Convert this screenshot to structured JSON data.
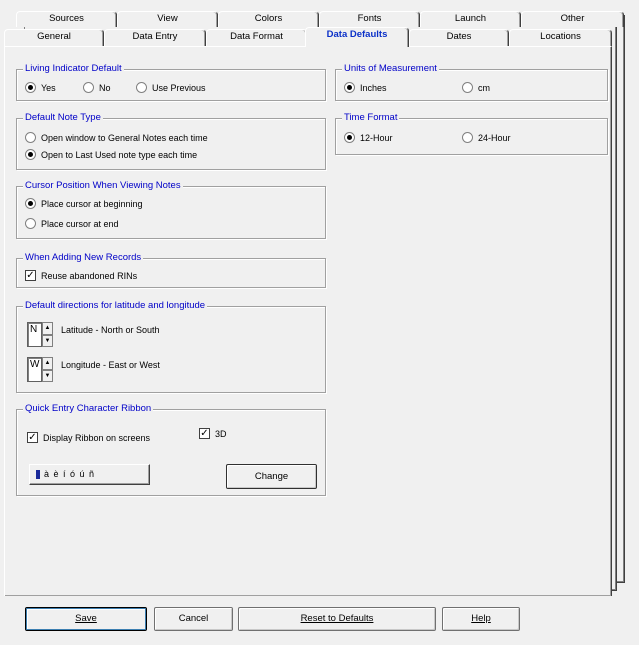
{
  "tabs_row1": [
    "Sources",
    "View",
    "Colors",
    "Fonts",
    "Launch",
    "Other"
  ],
  "tabs_row2": [
    "General",
    "Data Entry",
    "Data Format",
    "Data Defaults",
    "Dates",
    "Locations"
  ],
  "active_tab": "Data Defaults",
  "living": {
    "title": "Living Indicator Default",
    "options": [
      "Yes",
      "No",
      "Use Previous"
    ],
    "selected": "Yes"
  },
  "note_type": {
    "title": "Default Note Type",
    "options": [
      "Open window to General Notes each time",
      "Open to Last Used note type each time"
    ],
    "selected": "Open to Last Used note type each time"
  },
  "cursor": {
    "title": "Cursor Position When Viewing Notes",
    "options": [
      "Place cursor at beginning",
      "Place cursor at end"
    ],
    "selected": "Place cursor at beginning"
  },
  "new_records": {
    "title": "When Adding New Records",
    "reuse_label": "Reuse abandoned RINs",
    "reuse_checked": true
  },
  "directions": {
    "title": "Default directions for latitude and longitude",
    "latitude_value": "N",
    "latitude_label": "Latitude - North or South",
    "longitude_value": "W",
    "longitude_label": "Longitude - East or West"
  },
  "ribbon": {
    "title": "Quick Entry Character Ribbon",
    "display_label": "Display Ribbon on screens",
    "display_checked": true,
    "threed_label": "3D",
    "threed_checked": true,
    "chars": "à è í ó ú ñ",
    "change_label": "Change"
  },
  "units": {
    "title": "Units of Measurement",
    "options": [
      "Inches",
      "cm"
    ],
    "selected": "Inches"
  },
  "time_format": {
    "title": "Time Format",
    "options": [
      "12-Hour",
      "24-Hour"
    ],
    "selected": "12-Hour"
  },
  "buttons": {
    "save": "Save",
    "cancel": "Cancel",
    "reset": "Reset to Defaults",
    "help": "Help"
  },
  "icons": {
    "radio_selected": "filled-dot",
    "checkbox_checked": "check-mark",
    "spinner": "up-down-arrows"
  }
}
